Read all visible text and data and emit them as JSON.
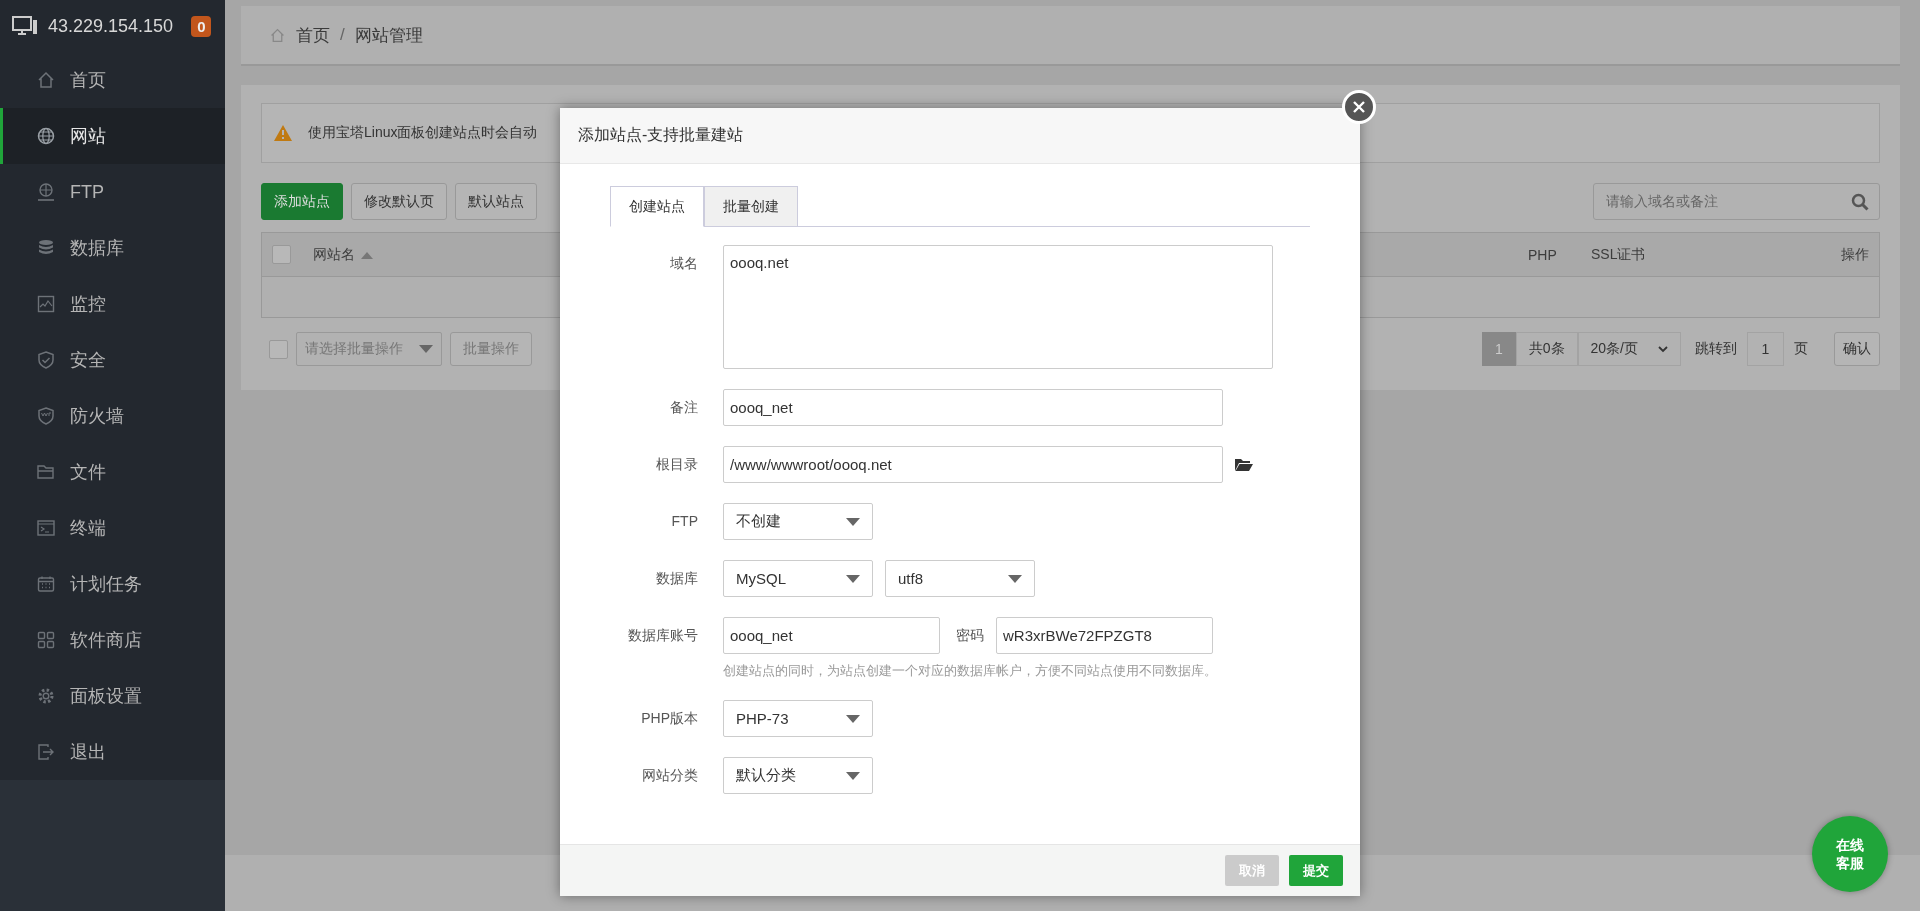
{
  "top_bar": {
    "ip": "43.229.154.150",
    "badge": "0"
  },
  "sidebar": {
    "items": [
      {
        "label": "首页",
        "selected": false
      },
      {
        "label": "网站",
        "selected": true
      },
      {
        "label": "FTP",
        "selected": false
      },
      {
        "label": "数据库",
        "selected": false
      },
      {
        "label": "监控",
        "selected": false
      },
      {
        "label": "安全",
        "selected": false
      },
      {
        "label": "防火墙",
        "selected": false
      },
      {
        "label": "文件",
        "selected": false
      },
      {
        "label": "终端",
        "selected": false
      },
      {
        "label": "计划任务",
        "selected": false
      },
      {
        "label": "软件商店",
        "selected": false
      },
      {
        "label": "面板设置",
        "selected": false
      },
      {
        "label": "退出",
        "selected": false
      }
    ]
  },
  "breadcrumb": [
    "首页",
    "/",
    "网站管理"
  ],
  "notice": "使用宝塔Linux面板创建站点时会自动",
  "toolbar": {
    "buttons": [
      {
        "label": "添加站点",
        "kind": "primary"
      },
      {
        "label": "修改默认页",
        "kind": "default"
      },
      {
        "label": "默认站点",
        "kind": "default"
      }
    ],
    "search": {
      "placeholder": "请输入域名或备注"
    }
  },
  "table": {
    "select_all": {
      "checked": false
    },
    "columns": [
      {
        "label": "网站名"
      },
      {
        "label": "PHP"
      },
      {
        "label": "SSL证书"
      },
      {
        "label": "操作"
      }
    ]
  },
  "bulk": {
    "checkbox": {
      "checked": false
    },
    "select": {
      "placeholder": "请选择批量操作"
    },
    "button": "批量操作"
  },
  "pagination": {
    "current": "1",
    "total": "共0条",
    "page_size": "20条/页",
    "jump_label": "跳转到",
    "jump_value": "1",
    "page_unit": "页",
    "confirm": "确认"
  },
  "dialog": {
    "title": "添加站点-支持批量建站",
    "tabs": [
      {
        "label": "创建站点",
        "selected": true
      },
      {
        "label": "批量创建",
        "selected": false
      }
    ],
    "fields": [
      {
        "label": "域名",
        "kind": "textarea",
        "value": "oooq.net"
      },
      {
        "label": "备注",
        "kind": "input",
        "value": "oooq_net"
      },
      {
        "label": "根目录",
        "kind": "path",
        "value": "/www/wwwroot/oooq.net"
      },
      {
        "label": "FTP",
        "kind": "select",
        "values": [
          "不创建"
        ]
      },
      {
        "label": "数据库",
        "kind": "select",
        "values": [
          "MySQL",
          "utf8"
        ]
      },
      {
        "label": "数据库账号",
        "kind": "account",
        "value": "oooq_net",
        "password_label": "密码",
        "password": "wR3xrBWe72FPZGT8",
        "help": "创建站点的同时，为站点创建一个对应的数据库帐户，方便不同站点使用不同数据库。"
      },
      {
        "label": "PHP版本",
        "kind": "select",
        "values": [
          "PHP-73"
        ]
      },
      {
        "label": "网站分类",
        "kind": "select",
        "values": [
          "默认分类"
        ]
      }
    ],
    "buttons": [
      {
        "label": "取消",
        "kind": "cancel"
      },
      {
        "label": "提交",
        "kind": "primary"
      }
    ]
  },
  "chat_button": {
    "label": "在线客服"
  }
}
